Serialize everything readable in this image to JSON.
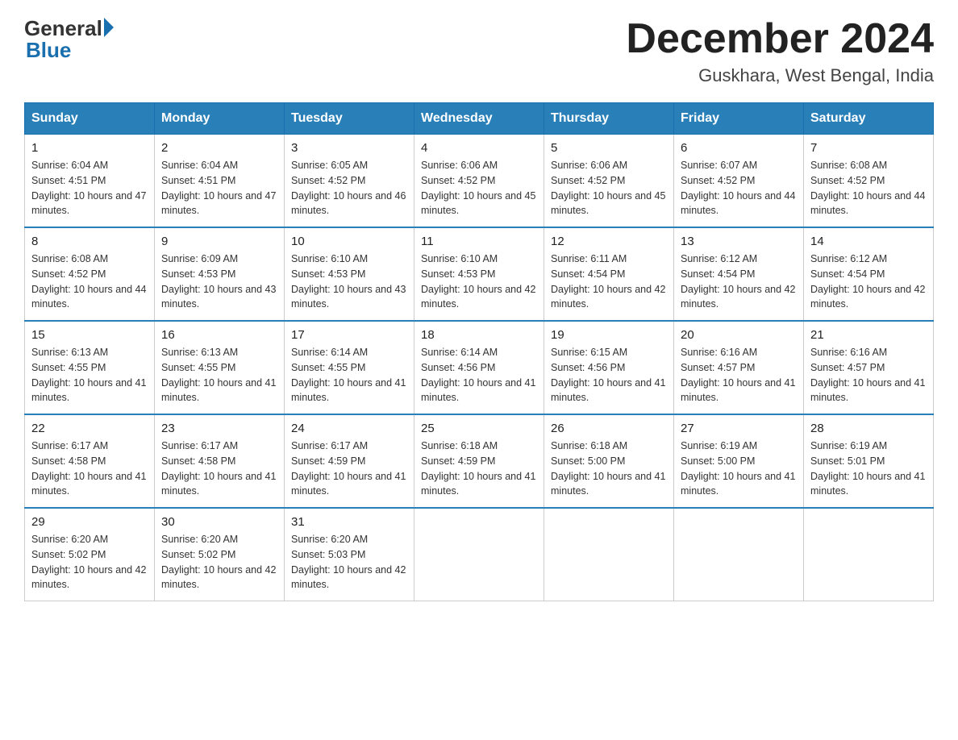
{
  "logo": {
    "general": "General",
    "blue": "Blue"
  },
  "title": "December 2024",
  "subtitle": "Guskhara, West Bengal, India",
  "days_header": [
    "Sunday",
    "Monday",
    "Tuesday",
    "Wednesday",
    "Thursday",
    "Friday",
    "Saturday"
  ],
  "weeks": [
    [
      {
        "day": "1",
        "sunrise": "6:04 AM",
        "sunset": "4:51 PM",
        "daylight": "10 hours and 47 minutes."
      },
      {
        "day": "2",
        "sunrise": "6:04 AM",
        "sunset": "4:51 PM",
        "daylight": "10 hours and 47 minutes."
      },
      {
        "day": "3",
        "sunrise": "6:05 AM",
        "sunset": "4:52 PM",
        "daylight": "10 hours and 46 minutes."
      },
      {
        "day": "4",
        "sunrise": "6:06 AM",
        "sunset": "4:52 PM",
        "daylight": "10 hours and 45 minutes."
      },
      {
        "day": "5",
        "sunrise": "6:06 AM",
        "sunset": "4:52 PM",
        "daylight": "10 hours and 45 minutes."
      },
      {
        "day": "6",
        "sunrise": "6:07 AM",
        "sunset": "4:52 PM",
        "daylight": "10 hours and 44 minutes."
      },
      {
        "day": "7",
        "sunrise": "6:08 AM",
        "sunset": "4:52 PM",
        "daylight": "10 hours and 44 minutes."
      }
    ],
    [
      {
        "day": "8",
        "sunrise": "6:08 AM",
        "sunset": "4:52 PM",
        "daylight": "10 hours and 44 minutes."
      },
      {
        "day": "9",
        "sunrise": "6:09 AM",
        "sunset": "4:53 PM",
        "daylight": "10 hours and 43 minutes."
      },
      {
        "day": "10",
        "sunrise": "6:10 AM",
        "sunset": "4:53 PM",
        "daylight": "10 hours and 43 minutes."
      },
      {
        "day": "11",
        "sunrise": "6:10 AM",
        "sunset": "4:53 PM",
        "daylight": "10 hours and 42 minutes."
      },
      {
        "day": "12",
        "sunrise": "6:11 AM",
        "sunset": "4:54 PM",
        "daylight": "10 hours and 42 minutes."
      },
      {
        "day": "13",
        "sunrise": "6:12 AM",
        "sunset": "4:54 PM",
        "daylight": "10 hours and 42 minutes."
      },
      {
        "day": "14",
        "sunrise": "6:12 AM",
        "sunset": "4:54 PM",
        "daylight": "10 hours and 42 minutes."
      }
    ],
    [
      {
        "day": "15",
        "sunrise": "6:13 AM",
        "sunset": "4:55 PM",
        "daylight": "10 hours and 41 minutes."
      },
      {
        "day": "16",
        "sunrise": "6:13 AM",
        "sunset": "4:55 PM",
        "daylight": "10 hours and 41 minutes."
      },
      {
        "day": "17",
        "sunrise": "6:14 AM",
        "sunset": "4:55 PM",
        "daylight": "10 hours and 41 minutes."
      },
      {
        "day": "18",
        "sunrise": "6:14 AM",
        "sunset": "4:56 PM",
        "daylight": "10 hours and 41 minutes."
      },
      {
        "day": "19",
        "sunrise": "6:15 AM",
        "sunset": "4:56 PM",
        "daylight": "10 hours and 41 minutes."
      },
      {
        "day": "20",
        "sunrise": "6:16 AM",
        "sunset": "4:57 PM",
        "daylight": "10 hours and 41 minutes."
      },
      {
        "day": "21",
        "sunrise": "6:16 AM",
        "sunset": "4:57 PM",
        "daylight": "10 hours and 41 minutes."
      }
    ],
    [
      {
        "day": "22",
        "sunrise": "6:17 AM",
        "sunset": "4:58 PM",
        "daylight": "10 hours and 41 minutes."
      },
      {
        "day": "23",
        "sunrise": "6:17 AM",
        "sunset": "4:58 PM",
        "daylight": "10 hours and 41 minutes."
      },
      {
        "day": "24",
        "sunrise": "6:17 AM",
        "sunset": "4:59 PM",
        "daylight": "10 hours and 41 minutes."
      },
      {
        "day": "25",
        "sunrise": "6:18 AM",
        "sunset": "4:59 PM",
        "daylight": "10 hours and 41 minutes."
      },
      {
        "day": "26",
        "sunrise": "6:18 AM",
        "sunset": "5:00 PM",
        "daylight": "10 hours and 41 minutes."
      },
      {
        "day": "27",
        "sunrise": "6:19 AM",
        "sunset": "5:00 PM",
        "daylight": "10 hours and 41 minutes."
      },
      {
        "day": "28",
        "sunrise": "6:19 AM",
        "sunset": "5:01 PM",
        "daylight": "10 hours and 41 minutes."
      }
    ],
    [
      {
        "day": "29",
        "sunrise": "6:20 AM",
        "sunset": "5:02 PM",
        "daylight": "10 hours and 42 minutes."
      },
      {
        "day": "30",
        "sunrise": "6:20 AM",
        "sunset": "5:02 PM",
        "daylight": "10 hours and 42 minutes."
      },
      {
        "day": "31",
        "sunrise": "6:20 AM",
        "sunset": "5:03 PM",
        "daylight": "10 hours and 42 minutes."
      },
      null,
      null,
      null,
      null
    ]
  ]
}
